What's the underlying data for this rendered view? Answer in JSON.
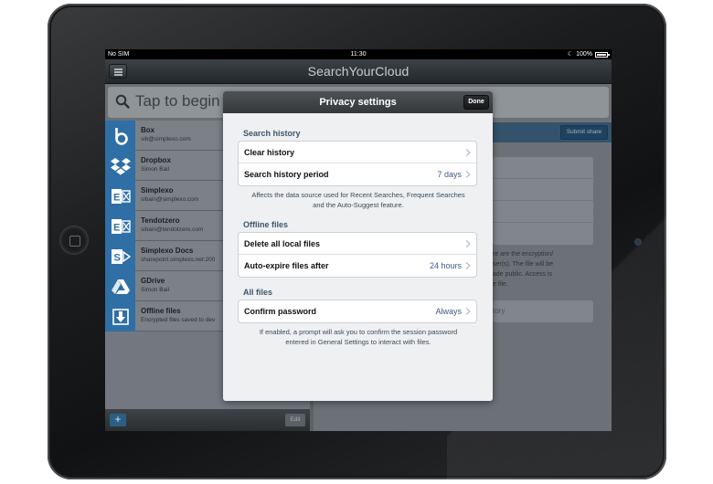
{
  "statusbar": {
    "carrier": "No SIM",
    "time": "11:30",
    "battery": "100%"
  },
  "app": {
    "title": "SearchYourCloud"
  },
  "search": {
    "placeholder": "Tap to begin"
  },
  "sources": [
    {
      "name": "Box",
      "sub": "sib@simplexo.com",
      "icon": "box-icon"
    },
    {
      "name": "Dropbox",
      "sub": "Simon Bail",
      "icon": "dropbox-icon"
    },
    {
      "name": "Simplexo",
      "sub": "sibain@simplexo.com",
      "icon": "exchange-icon"
    },
    {
      "name": "Tendotzero",
      "sub": "sibain@tendotzero.com",
      "icon": "exchange-icon"
    },
    {
      "name": "Simplexo Docs",
      "sub": "sharepoint.simplexo.net:200",
      "icon": "sharepoint-icon"
    },
    {
      "name": "GDrive",
      "sub": "Simon Bail",
      "icon": "gdrive-icon"
    },
    {
      "name": "Offline files",
      "sub": "Encrypted files saved to dev",
      "icon": "download-icon"
    }
  ],
  "toolbar": {
    "add_label": "+",
    "edit_label": "Edit"
  },
  "detail": {
    "submit_label": "Submit share",
    "text_lines": [
      "re are the encryption/",
      "ser(s). The file will be",
      "ade public. Access is",
      "e file."
    ],
    "input_placeholder": "tory"
  },
  "modal": {
    "title": "Privacy settings",
    "done_label": "Done",
    "sections": [
      {
        "label": "Search history",
        "rows": [
          {
            "label": "Clear history",
            "value": ""
          },
          {
            "label": "Search history period",
            "value": "7 days"
          }
        ],
        "note": "Affects the data source used for Recent Searches, Frequent Searches and the Auto-Suggest feature."
      },
      {
        "label": "Offline files",
        "rows": [
          {
            "label": "Delete all local files",
            "value": ""
          },
          {
            "label": "Auto-expire files after",
            "value": "24 hours"
          }
        ],
        "note": ""
      },
      {
        "label": "All files",
        "rows": [
          {
            "label": "Confirm password",
            "value": "Always"
          }
        ],
        "note": "If enabled, a prompt will ask you to confirm the session password entered in General Settings to interact with files."
      }
    ]
  },
  "colors": {
    "accent": "#3b5a86",
    "section_label": "#3f556b",
    "modal_header": "#34383b",
    "source_icon_bg": "#2f6fa6"
  }
}
